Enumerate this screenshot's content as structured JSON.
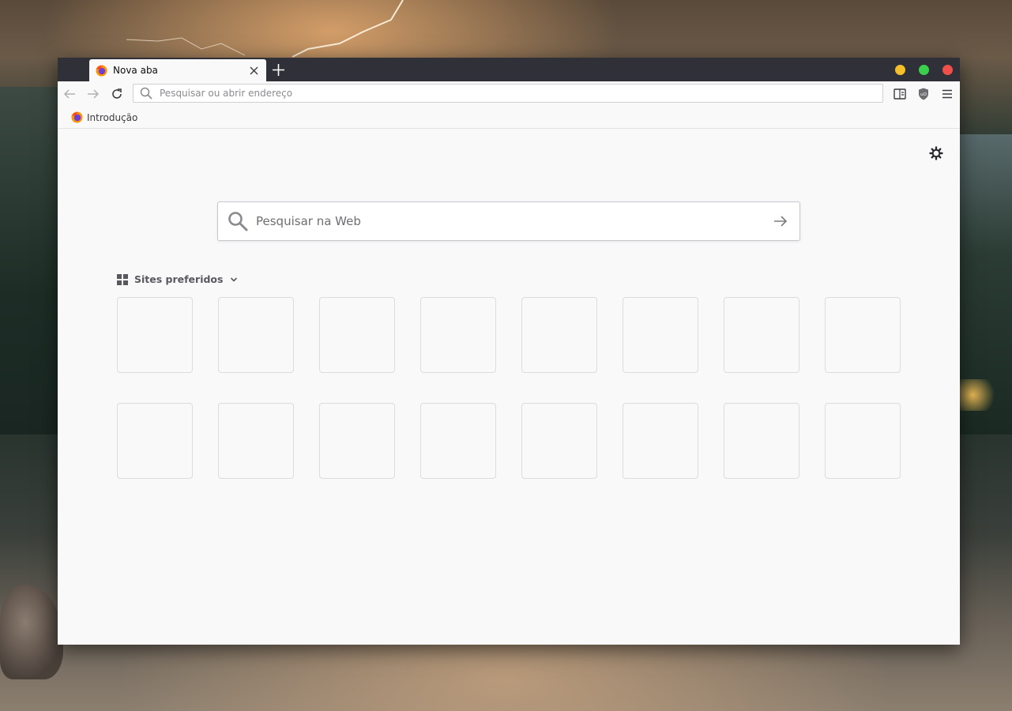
{
  "tab": {
    "title": "Nova aba"
  },
  "urlbar": {
    "placeholder": "Pesquisar ou abrir endereço"
  },
  "bookmarks": [
    {
      "label": "Introdução"
    }
  ],
  "newtab_page": {
    "search_placeholder": "Pesquisar na Web",
    "top_sites_label": "Sites preferidos",
    "tile_count": 16
  },
  "colors": {
    "titlebar": "#2f3038",
    "page_background": "#f9f9fa",
    "minimize": "#f4bf2a",
    "maximize": "#3ccf4e",
    "close": "#f0504a"
  },
  "icons": [
    "firefox-icon",
    "close-icon",
    "plus-icon",
    "back-arrow-icon",
    "forward-arrow-icon",
    "reload-icon",
    "search-icon",
    "reader-view-icon",
    "ublock-shield-icon",
    "hamburger-menu-icon",
    "gear-icon",
    "arrow-right-icon",
    "grid-icon",
    "chevron-down-icon"
  ]
}
